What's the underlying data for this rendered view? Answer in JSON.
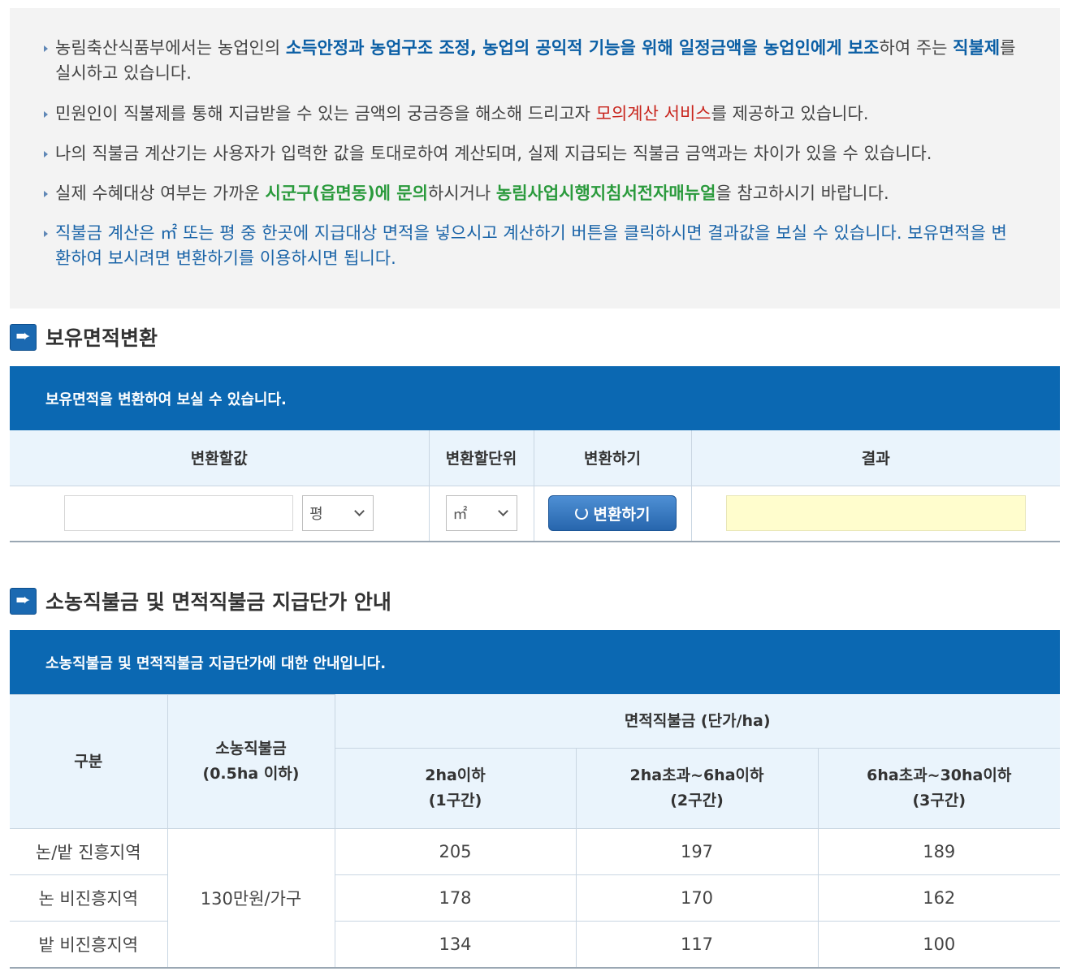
{
  "notice": {
    "b1_pre": "농림축산식품부에서는 농업인의 ",
    "b1_hl": "소득안정과 농업구조 조정, 농업의 공익적 기능을 위해 일정금액을 농업인에게 보조",
    "b1_mid": "하여 주는 ",
    "b1_hl2": "직불제",
    "b1_post": "를 실시하고 있습니다.",
    "b2_pre": "민원인이 직불제를 통해 지급받을 수 있는 금액의 궁금증을 해소해 드리고자 ",
    "b2_hl": "모의계산 서비스",
    "b2_post": "를 제공하고 있습니다.",
    "b3": "나의 직불금 계산기는 사용자가 입력한 값을 토대로하여 계산되며, 실제 지급되는 직불금 금액과는 차이가 있을 수 있습니다.",
    "b4_pre": "실제 수혜대상 여부는 가까운 ",
    "b4_hl": "시군구(읍면동)에 문의",
    "b4_mid": "하시거나 ",
    "b4_hl2": "농림사업시행지침서전자매뉴얼",
    "b4_post": "을 참고하시기 바랍니다.",
    "b5": "직불금 계산은 ㎡ 또는 평 중 한곳에 지급대상 면적을 넣으시고 계산하기 버튼을 클릭하시면 결과값을 보실 수 있습니다. 보유면적을 변환하여 보시려면 변환하기를 이용하시면 됩니다."
  },
  "convert": {
    "title": "보유면적변환",
    "banner": "보유면적을 변환하여 보실 수 있습니다.",
    "col_value": "변환할값",
    "col_unit": "변환할단위",
    "col_action": "변환하기",
    "col_result": "결과",
    "value_input": "",
    "from_unit": "평",
    "to_unit": "㎡",
    "button": "변환하기",
    "result": ""
  },
  "price": {
    "title": "소농직불금 및 면적직불금 지급단가 안내",
    "banner": "소농직불금 및 면적직불금 지급단가에 대한 안내입니다.",
    "h_category": "구분",
    "h_small_1": "소농직불금",
    "h_small_2": "(0.5ha 이하)",
    "h_area": "면적직불금 (단가/ha)",
    "tiers": [
      {
        "l1": "2ha이하",
        "l2": "(1구간)"
      },
      {
        "l1": "2ha초과~6ha이하",
        "l2": "(2구간)"
      },
      {
        "l1": "6ha초과~30ha이하",
        "l2": "(3구간)"
      }
    ],
    "small_value": "130만원/가구",
    "rows": [
      {
        "name": "논/밭 진흥지역",
        "v": [
          "205",
          "197",
          "189"
        ]
      },
      {
        "name": "논 비진흥지역",
        "v": [
          "178",
          "170",
          "162"
        ]
      },
      {
        "name": "밭 비진흥지역",
        "v": [
          "134",
          "117",
          "100"
        ]
      }
    ]
  }
}
